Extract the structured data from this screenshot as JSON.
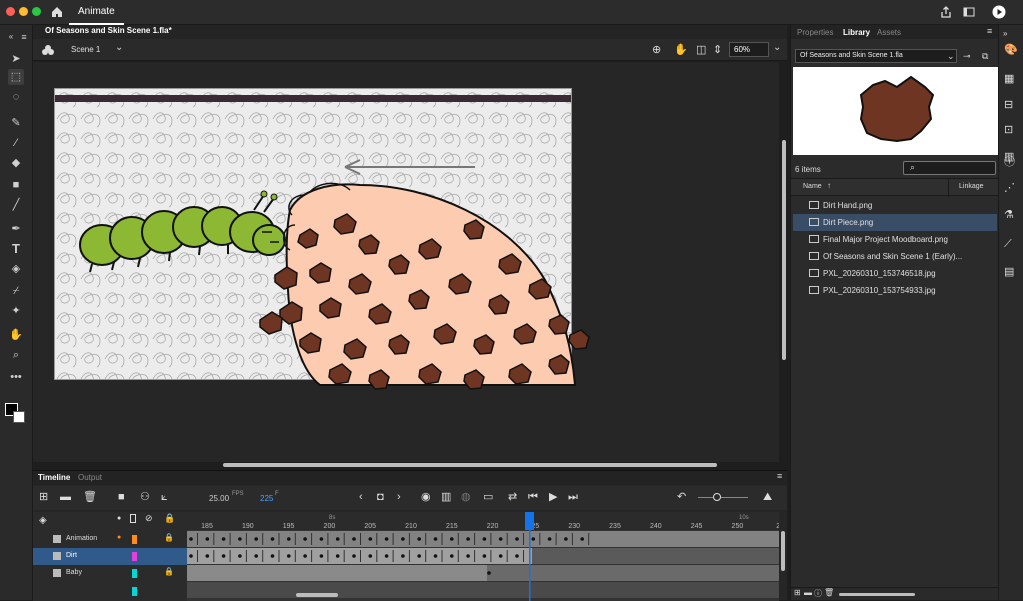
{
  "app": {
    "tab_label": "Animate"
  },
  "document": {
    "tab_title": "Of Seasons and Skin Scene 1.fla*"
  },
  "scene": {
    "name": "Scene 1",
    "zoom": "60%"
  },
  "right_panel": {
    "tabs": [
      "Properties",
      "Library",
      "Assets"
    ],
    "library_dropdown": "Of Seasons and Skin Scene 1.fla",
    "item_count": "6 items",
    "columns": {
      "name": "Name",
      "linkage": "Linkage"
    },
    "items": [
      "Dirt Hand.png",
      "Dirt Piece.png",
      "Final Major Project Moodboard.png",
      "Of Seasons and Skin Scene 1 (Early)...",
      "PXL_20260310_153746518.jpg",
      "PXL_20260310_153754933.jpg"
    ],
    "selected_index": 1
  },
  "timeline": {
    "tabs": [
      "Timeline",
      "Output"
    ],
    "fps": "25.00",
    "fps_unit": "FPS",
    "frame": "225",
    "frame_unit": "F",
    "ruler_seconds": [
      "8s",
      "10s"
    ],
    "ruler_frames": [
      "185",
      "190",
      "195",
      "200",
      "205",
      "210",
      "215",
      "220",
      "225",
      "230",
      "235",
      "240",
      "245",
      "250",
      "2"
    ],
    "playhead_frame": 225,
    "layers": [
      {
        "name": "Animation",
        "color": "#ff8c1a",
        "selected": false
      },
      {
        "name": "Dirt",
        "color": "#e040e0",
        "selected": true
      },
      {
        "name": "Baby",
        "color": "#00d8d8",
        "selected": false
      }
    ]
  },
  "colors": {
    "accent": "#1473e6",
    "panel": "#2b2b2b",
    "selected_layer": "#2f5a8a"
  }
}
